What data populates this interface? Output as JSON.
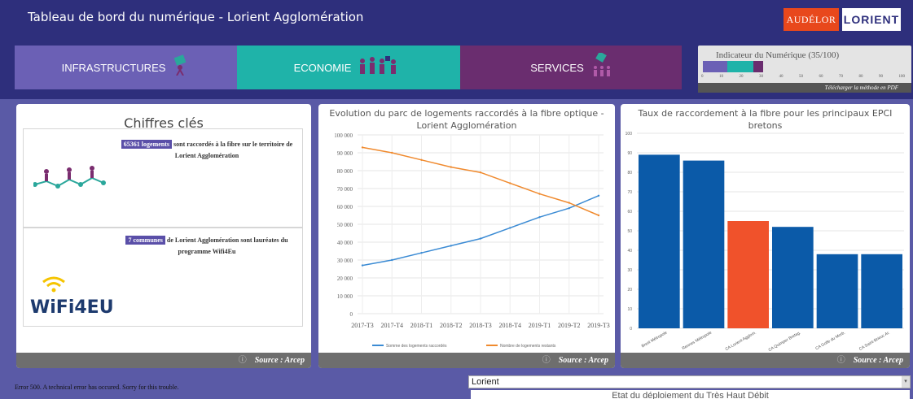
{
  "header": {
    "title": "Tableau de bord du numérique - Lorient Agglomération",
    "logo_audelor": "AUDÉLOR",
    "logo_lorient": "LORIENT"
  },
  "tabs": [
    {
      "label": "INFRASTRUCTURES"
    },
    {
      "label": "ECONOMIE"
    },
    {
      "label": "SERVICES"
    }
  ],
  "indicator": {
    "label": "Indicateur du Numérique (35/100)",
    "value": 35,
    "max": 100,
    "ticks": [
      "0",
      "10",
      "20",
      "30",
      "40",
      "50",
      "60",
      "70",
      "80",
      "90",
      "100"
    ],
    "download": "Télécharger la méthode en PDF",
    "segment_colors": [
      "#6b60b5",
      "#1fb3a9",
      "#6a2d6f"
    ]
  },
  "panel1": {
    "title": "Chiffres clés",
    "card1_badge": "65361 logements",
    "card1_text": "sont raccordés à la fibre sur le territoire de Lorient Agglomération",
    "card2_badge": "7 communes",
    "card2_text": "de Lorient Agglomération sont lauréates du programme Wifi4Eu",
    "wifi_logo": "WiFi4EU"
  },
  "source": "Source : Arcep",
  "error": "Error 500. A technical error has occured. Sorry for this trouble.",
  "select": {
    "value": "Lorient"
  },
  "subpanel_title": "Etat du déploiement du Très Haut Débit",
  "chart_data": [
    {
      "type": "line",
      "title": "Evolution du parc de logements raccordés à la fibre optique - Lorient Agglomération",
      "categories": [
        "2017-T3",
        "2017-T4",
        "2018-T1",
        "2018-T2",
        "2018-T3",
        "2018-T4",
        "2019-T1",
        "2019-T2",
        "2019-T3"
      ],
      "ylim": [
        0,
        100000
      ],
      "yticks": [
        "100 000",
        "90 000",
        "80 000",
        "70 000",
        "60 000",
        "50 000",
        "40 000",
        "30 000",
        "20 000",
        "10 000",
        "0"
      ],
      "series": [
        {
          "name": "Somme des logements raccordés",
          "color": "#3b8bd4",
          "values": [
            27000,
            30000,
            34000,
            38000,
            42000,
            48000,
            54000,
            59000,
            66000
          ]
        },
        {
          "name": "Nombre de logements restants",
          "color": "#f08a2e",
          "values": [
            93000,
            90000,
            86000,
            82000,
            79000,
            73000,
            67000,
            62000,
            55000
          ]
        }
      ],
      "grid": true,
      "legend": "bottom"
    },
    {
      "type": "bar",
      "title": "Taux de raccordement à la fibre pour les principaux EPCI bretons",
      "categories": [
        "Brest Métropole",
        "Rennes Métropole",
        "CA Lorient Agglom.",
        "CA Quimper Bretag.",
        "CA Golfe du Morb.",
        "CA Saint-Brieuc Ar."
      ],
      "values": [
        89,
        86,
        55,
        52,
        38,
        38
      ],
      "colors": [
        "#0b5aa8",
        "#0b5aa8",
        "#f0522b",
        "#0b5aa8",
        "#0b5aa8",
        "#0b5aa8"
      ],
      "ylim": [
        0,
        100
      ],
      "yticks": [
        "100",
        "90",
        "80",
        "70",
        "60",
        "50",
        "40",
        "30",
        "20",
        "10",
        "0"
      ],
      "grid": true
    }
  ]
}
